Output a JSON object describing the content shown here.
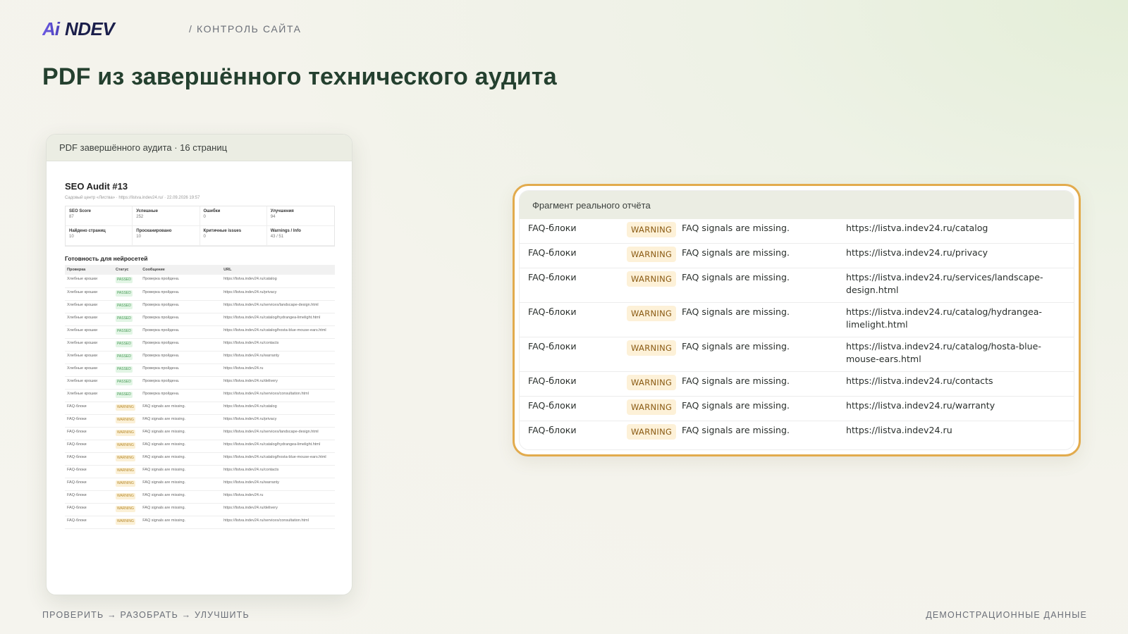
{
  "header": {
    "logo_text": "AiNDEV",
    "subtitle": "/ КОНТРОЛЬ САЙТА"
  },
  "page_title": "PDF из завершённого технического аудита",
  "pdf_card": {
    "header": "PDF завершённого аудита · 16 страниц",
    "doc_title": "SEO Audit #13",
    "doc_meta": "Садовый центр «Листва» · https://listva.indev24.ru/ · 22.09.2026 19:57",
    "stats": [
      {
        "label": "SEO Score",
        "value": "87"
      },
      {
        "label": "Успешные",
        "value": "252"
      },
      {
        "label": "Ошибки",
        "value": "0"
      },
      {
        "label": "Улучшения",
        "value": "94"
      },
      {
        "label": "Найдено страниц",
        "value": "10"
      },
      {
        "label": "Просканировано",
        "value": "10"
      },
      {
        "label": "Критичные issues",
        "value": "0"
      },
      {
        "label": "Warnings / Info",
        "value": "43 / 51"
      }
    ],
    "section_title": "Готовность для нейросетей",
    "columns": [
      "Проверка",
      "Статус",
      "Сообщение",
      "URL"
    ],
    "rows": [
      {
        "check": "Хлебные крошки",
        "status": "PASSED",
        "message": "Проверка пройдена.",
        "url": "https://listva.indev24.ru/catalog"
      },
      {
        "check": "Хлебные крошки",
        "status": "PASSED",
        "message": "Проверка пройдена.",
        "url": "https://listva.indev24.ru/privacy"
      },
      {
        "check": "Хлебные крошки",
        "status": "PASSED",
        "message": "Проверка пройдена.",
        "url": "https://listva.indev24.ru/services/landscape-design.html"
      },
      {
        "check": "Хлебные крошки",
        "status": "PASSED",
        "message": "Проверка пройдена.",
        "url": "https://listva.indev24.ru/catalog/hydrangea-limelight.html"
      },
      {
        "check": "Хлебные крошки",
        "status": "PASSED",
        "message": "Проверка пройдена.",
        "url": "https://listva.indev24.ru/catalog/hosta-blue-mouse-ears.html"
      },
      {
        "check": "Хлебные крошки",
        "status": "PASSED",
        "message": "Проверка пройдена.",
        "url": "https://listva.indev24.ru/contacts"
      },
      {
        "check": "Хлебные крошки",
        "status": "PASSED",
        "message": "Проверка пройдена.",
        "url": "https://listva.indev24.ru/warranty"
      },
      {
        "check": "Хлебные крошки",
        "status": "PASSED",
        "message": "Проверка пройдена.",
        "url": "https://listva.indev24.ru"
      },
      {
        "check": "Хлебные крошки",
        "status": "PASSED",
        "message": "Проверка пройдена.",
        "url": "https://listva.indev24.ru/delivery"
      },
      {
        "check": "Хлебные крошки",
        "status": "PASSED",
        "message": "Проверка пройдена.",
        "url": "https://listva.indev24.ru/services/consultation.html"
      },
      {
        "check": "FAQ-блоки",
        "status": "WARNING",
        "message": "FAQ signals are missing.",
        "url": "https://listva.indev24.ru/catalog"
      },
      {
        "check": "FAQ-блоки",
        "status": "WARNING",
        "message": "FAQ signals are missing.",
        "url": "https://listva.indev24.ru/privacy"
      },
      {
        "check": "FAQ-блоки",
        "status": "WARNING",
        "message": "FAQ signals are missing.",
        "url": "https://listva.indev24.ru/services/landscape-design.html"
      },
      {
        "check": "FAQ-блоки",
        "status": "WARNING",
        "message": "FAQ signals are missing.",
        "url": "https://listva.indev24.ru/catalog/hydrangea-limelight.html"
      },
      {
        "check": "FAQ-блоки",
        "status": "WARNING",
        "message": "FAQ signals are missing.",
        "url": "https://listva.indev24.ru/catalog/hosta-blue-mouse-ears.html"
      },
      {
        "check": "FAQ-блоки",
        "status": "WARNING",
        "message": "FAQ signals are missing.",
        "url": "https://listva.indev24.ru/contacts"
      },
      {
        "check": "FAQ-блоки",
        "status": "WARNING",
        "message": "FAQ signals are missing.",
        "url": "https://listva.indev24.ru/warranty"
      },
      {
        "check": "FAQ-блоки",
        "status": "WARNING",
        "message": "FAQ signals are missing.",
        "url": "https://listva.indev24.ru"
      },
      {
        "check": "FAQ-блоки",
        "status": "WARNING",
        "message": "FAQ signals are missing.",
        "url": "https://listva.indev24.ru/delivery"
      },
      {
        "check": "FAQ-блоки",
        "status": "WARNING",
        "message": "FAQ signals are missing.",
        "url": "https://listva.indev24.ru/services/consultation.html"
      }
    ]
  },
  "fragment": {
    "header": "Фрагмент реального отчёта",
    "rows": [
      {
        "check": "FAQ-блоки",
        "status": "WARNING",
        "message": "FAQ signals are missing.",
        "url": "https://listva.indev24.ru/catalog"
      },
      {
        "check": "FAQ-блоки",
        "status": "WARNING",
        "message": "FAQ signals are missing.",
        "url": "https://listva.indev24.ru/privacy"
      },
      {
        "check": "FAQ-блоки",
        "status": "WARNING",
        "message": "FAQ signals are missing.",
        "url": "https://listva.indev24.ru/services/landscape-design.html"
      },
      {
        "check": "FAQ-блоки",
        "status": "WARNING",
        "message": "FAQ signals are missing.",
        "url": "https://listva.indev24.ru/catalog/hydrangea-limelight.html"
      },
      {
        "check": "FAQ-блоки",
        "status": "WARNING",
        "message": "FAQ signals are missing.",
        "url": "https://listva.indev24.ru/catalog/hosta-blue-mouse-ears.html"
      },
      {
        "check": "FAQ-блоки",
        "status": "WARNING",
        "message": "FAQ signals are missing.",
        "url": "https://listva.indev24.ru/contacts"
      },
      {
        "check": "FAQ-блоки",
        "status": "WARNING",
        "message": "FAQ signals are missing.",
        "url": "https://listva.indev24.ru/warranty"
      },
      {
        "check": "FAQ-блоки",
        "status": "WARNING",
        "message": "FAQ signals are missing.",
        "url": "https://listva.indev24.ru"
      }
    ]
  },
  "footer": {
    "left": "ПРОВЕРИТЬ → РАЗОБРАТЬ → УЛУЧШИТЬ",
    "right": "ДЕМОНСТРАЦИОННЫЕ ДАННЫЕ"
  },
  "colors": {
    "accent": "#e2ab4d",
    "title": "#24402f",
    "logo_gradient_start": "#6e5ce6",
    "logo_navy": "#1b1f4b",
    "warning_bg": "#fdf1d8",
    "passed_bg": "#e2f5e5"
  }
}
